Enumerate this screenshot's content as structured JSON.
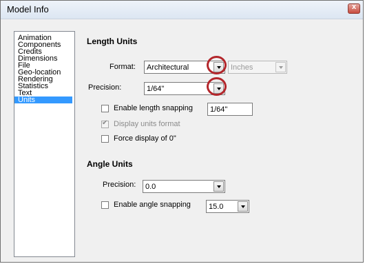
{
  "window": {
    "title": "Model Info",
    "close_glyph": "x"
  },
  "sidebar": {
    "items": [
      {
        "label": "Animation"
      },
      {
        "label": "Components"
      },
      {
        "label": "Credits"
      },
      {
        "label": "Dimensions"
      },
      {
        "label": "File"
      },
      {
        "label": "Geo-location"
      },
      {
        "label": "Rendering"
      },
      {
        "label": "Statistics"
      },
      {
        "label": "Text"
      },
      {
        "label": "Units",
        "selected": true
      }
    ]
  },
  "length_units": {
    "title": "Length Units",
    "format_label": "Format:",
    "format_value": "Architectural",
    "unit_value": "Inches",
    "precision_label": "Precision:",
    "precision_value": "1/64\"",
    "enable_snapping_label": "Enable length snapping",
    "snapping_value": "1/64\"",
    "snapping_checked": false,
    "display_units_label": "Display units format",
    "display_units_checked": true,
    "display_units_enabled": false,
    "force_display_label": "Force display of 0\"",
    "force_display_checked": false
  },
  "angle_units": {
    "title": "Angle Units",
    "precision_label": "Precision:",
    "precision_value": "0.0",
    "enable_snapping_label": "Enable angle snapping",
    "snapping_value": "15.0",
    "snapping_checked": false
  },
  "colors": {
    "selection": "#3399ff",
    "highlight_ring": "#b3262b"
  }
}
